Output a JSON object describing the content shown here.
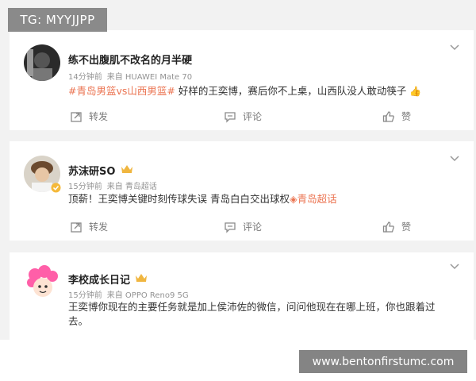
{
  "watermark_top": "TG: MYYJJPP",
  "watermark_bottom": "www.bentonfirstumc.com",
  "posts": [
    {
      "username": "练不出腹肌不改名的月半硬",
      "time": "14分钟前",
      "source": "来自 HUAWEI Mate 70",
      "tag": "#青岛男篮vs山西男篮#",
      "text": " 好样的王奕博，赛后你不上桌，山西队没人敢动筷子",
      "emoji": "👍",
      "repost_label": "转发",
      "comment_label": "评论",
      "like_label": "赞"
    },
    {
      "username": "苏沫研SO",
      "time": "15分钟前",
      "source": "来自 青岛超话",
      "text": "顶薪！王奕博关键时刻传球失误 青岛白白交出球权",
      "tag": "◈青岛超话",
      "repost_label": "转发",
      "comment_label": "评论",
      "like_label": "赞"
    },
    {
      "username": "李校成长日记",
      "time": "15分钟前",
      "source": "来自 OPPO Reno9 5G",
      "text": "王奕博你现在的主要任务就是加上侯沛佐的微信，问问他现在在哪上班，你也跟着过去。"
    }
  ],
  "colors": {
    "tag": "#eb7350",
    "meta": "#939393",
    "background": "#f2f2f2"
  }
}
